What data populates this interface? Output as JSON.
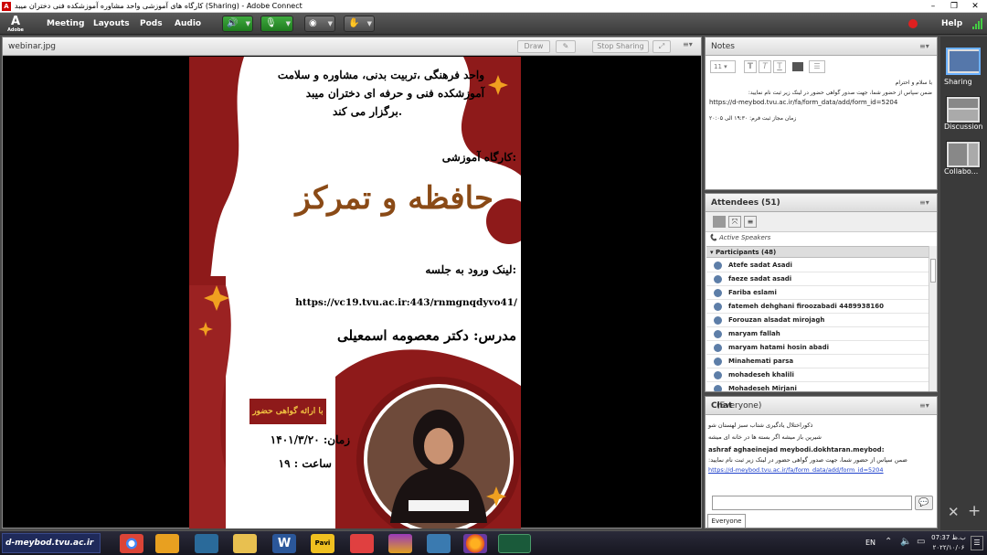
{
  "window": {
    "title": "کارگاه های آموزشی واحد مشاوره آموزشکده فنی دختران میبد (Sharing) - Adobe Connect",
    "buttons": [
      "–",
      "❐",
      "✕"
    ]
  },
  "menubar": {
    "logo": "A",
    "logo_sub": "Adobe",
    "items": [
      "Meeting",
      "Layouts",
      "Pods",
      "Audio"
    ],
    "help": "Help"
  },
  "share_pod": {
    "title": "webinar.jpg",
    "draw_label": "Draw",
    "stop_sharing_label": "Stop Sharing",
    "menu_glyph": "≡▾"
  },
  "poster": {
    "header_lines": [
      "واحد فرهنگی ،تربیت بدنی، مشاوره و سلامت",
      "آموزشکده فنی و حرفه ای دختران میبد",
      "برگزار می کند."
    ],
    "workshop_label": "کارگاه آموزشی:",
    "workshop_title": "حافظه و تمرکز",
    "link_label": "لینک ورود به جلسه:",
    "link_url": "https://vc19.tvu.ac.ir:443/rnmgnqdyvo41/",
    "instructor": "مدرس: دکتر معصومه اسمعیلی",
    "certificate": "با ارائه گواهی حضور",
    "date": "زمان: ۱۴۰۱/۳/۲۰",
    "time": "ساعت : ۱۹",
    "colors": {
      "maroon": "#8e1a1a",
      "gold": "#f0a020",
      "title_brown": "#8a4a16"
    }
  },
  "notes": {
    "title": "Notes",
    "font_size": "11",
    "line1": "با سلام و احترام",
    "line2": "ضمن سپاس از حضور شما، جهت صدور گواهی حضور در لینک زیر ثبت نام نمایید:",
    "link": "https://d-meybod.tvu.ac.ir/fa/form_data/add/form_id=5204",
    "line3": "زمان مجاز ثبت فرم: ۱۹:۳۰ الی ۲۰:۰۵"
  },
  "attendees": {
    "title": "Attendees",
    "count": "(51)",
    "active_speakers": "Active Speakers",
    "participants_label": "Participants (48)",
    "participants": [
      "Atefe sadat Asadi",
      "faeze sadat asadi",
      "Fariba eslami",
      "fatemeh dehghani firoozabadi 4489938160",
      "Forouzan alsadat mirojagh",
      "maryam fallah",
      "maryam hatami hosin abadi",
      "Minahemati parsa",
      "mohadeseh khalili",
      "Mohadeseh Mirjani"
    ]
  },
  "chat": {
    "title": "Chat",
    "scope": "(Everyone)",
    "messages": [
      "ذکوراختلال یادگیری شتاب سبز لهستان شو",
      "شیرین باز میشه اگر بسته ها در خانه ای میشه"
    ],
    "last_sender": "ashraf aghaeinejad meybodi.dokhtaran.meybod:",
    "last_text": "ضمن سپاس از حضور شما، جهت صدور گواهی حضور در لینک زیر ثبت نام نمایید:",
    "last_link": "https://d-meybod.tvu.ac.ir/fa/form_data/add/form_id=5204",
    "tab": "Everyone",
    "send_icon": "speech-bubble-icon"
  },
  "layouts": {
    "items": [
      "Sharing",
      "Discussion",
      "Collabo..."
    ]
  },
  "taskbar": {
    "brand": "d-meybod.tvu.ac.ir",
    "lang": "EN",
    "clock_time": "07:37 ب.ظ",
    "clock_date": "۲۰۲۲/۱۰/۰۶",
    "pavi_label": "Pavi",
    "word_label": "W"
  }
}
